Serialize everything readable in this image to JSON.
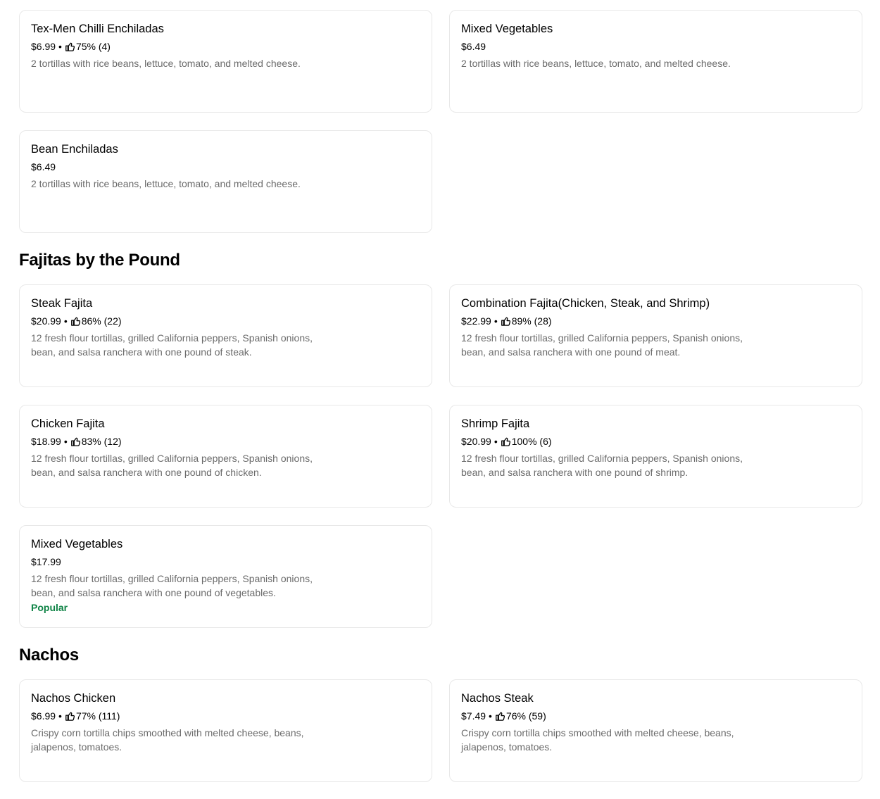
{
  "enchiladas_items": {
    "tex_men": {
      "name": "Tex-Men Chilli Enchiladas",
      "price": "$6.99",
      "rating": "75% (4)",
      "desc": "2 tortillas with rice beans, lettuce, tomato, and melted cheese."
    },
    "mixed_veg": {
      "name": "Mixed Vegetables",
      "price": "$6.49",
      "desc": "2 tortillas with rice beans, lettuce, tomato, and melted cheese."
    },
    "bean": {
      "name": "Bean Enchiladas",
      "price": "$6.49",
      "desc": "2 tortillas with rice beans, lettuce, tomato, and melted cheese."
    }
  },
  "fajitas": {
    "title": "Fajitas by the Pound",
    "steak": {
      "name": "Steak Fajita",
      "price": "$20.99",
      "rating": "86% (22)",
      "desc": "12 fresh flour tortillas, grilled California peppers, Spanish onions, bean, and salsa ranchera with one pound of steak."
    },
    "combination": {
      "name": "Combination Fajita(Chicken, Steak, and Shrimp)",
      "price": "$22.99",
      "rating": "89% (28)",
      "desc": "12 fresh flour tortillas, grilled California peppers, Spanish onions, bean, and salsa ranchera with one pound of meat."
    },
    "chicken": {
      "name": "Chicken Fajita",
      "price": "$18.99",
      "rating": "83% (12)",
      "desc": "12 fresh flour tortillas, grilled California peppers, Spanish onions, bean, and salsa ranchera with one pound of chicken."
    },
    "shrimp": {
      "name": "Shrimp Fajita",
      "price": "$20.99",
      "rating": "100% (6)",
      "desc": "12 fresh flour tortillas, grilled California peppers, Spanish onions, bean, and salsa ranchera with one pound of shrimp."
    },
    "mixed_veg": {
      "name": "Mixed Vegetables",
      "price": "$17.99",
      "desc": "12 fresh flour tortillas, grilled California peppers, Spanish onions, bean, and salsa ranchera with one pound of vegetables.",
      "badge": "Popular"
    }
  },
  "nachos": {
    "title": "Nachos",
    "chicken": {
      "name": "Nachos Chicken",
      "price": "$6.99",
      "rating": "77% (111)",
      "desc": "Crispy corn tortilla chips smoothed with melted cheese, beans, jalapenos, tomatoes."
    },
    "steak": {
      "name": "Nachos Steak",
      "price": "$7.49",
      "rating": "76% (59)",
      "desc": "Crispy corn tortilla chips smoothed with melted cheese, beans, jalapenos, tomatoes."
    }
  },
  "colors": {
    "popular_badge": "#0e8345",
    "description_text": "#6b6b6b",
    "card_border": "#e8e8e8"
  },
  "icons": {
    "rating": "thumbs-up-icon"
  }
}
